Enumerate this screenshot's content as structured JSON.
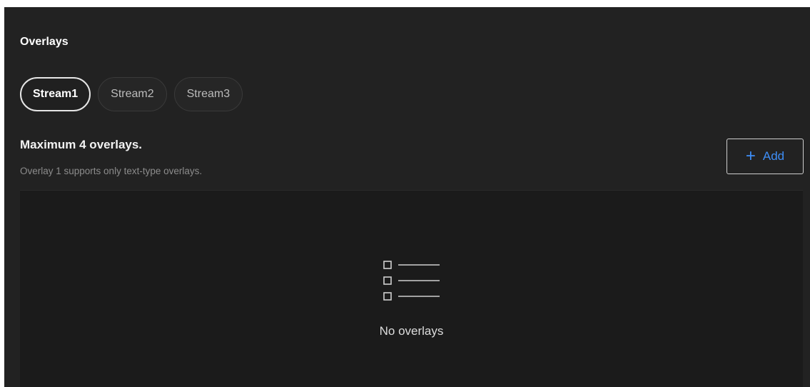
{
  "panel": {
    "title": "Overlays"
  },
  "tabs": [
    {
      "label": "Stream1",
      "active": true
    },
    {
      "label": "Stream2",
      "active": false
    },
    {
      "label": "Stream3",
      "active": false
    }
  ],
  "overlay_section": {
    "heading": "Maximum 4 overlays.",
    "note": "Overlay 1 supports only text-type overlays.",
    "add_label": "Add",
    "add_icon": "plus-icon"
  },
  "empty_state": {
    "icon": "list-icon",
    "text": "No overlays"
  },
  "colors": {
    "background": "#222222",
    "accent": "#3e8ef7",
    "empty_area": "#1b1b1b"
  }
}
